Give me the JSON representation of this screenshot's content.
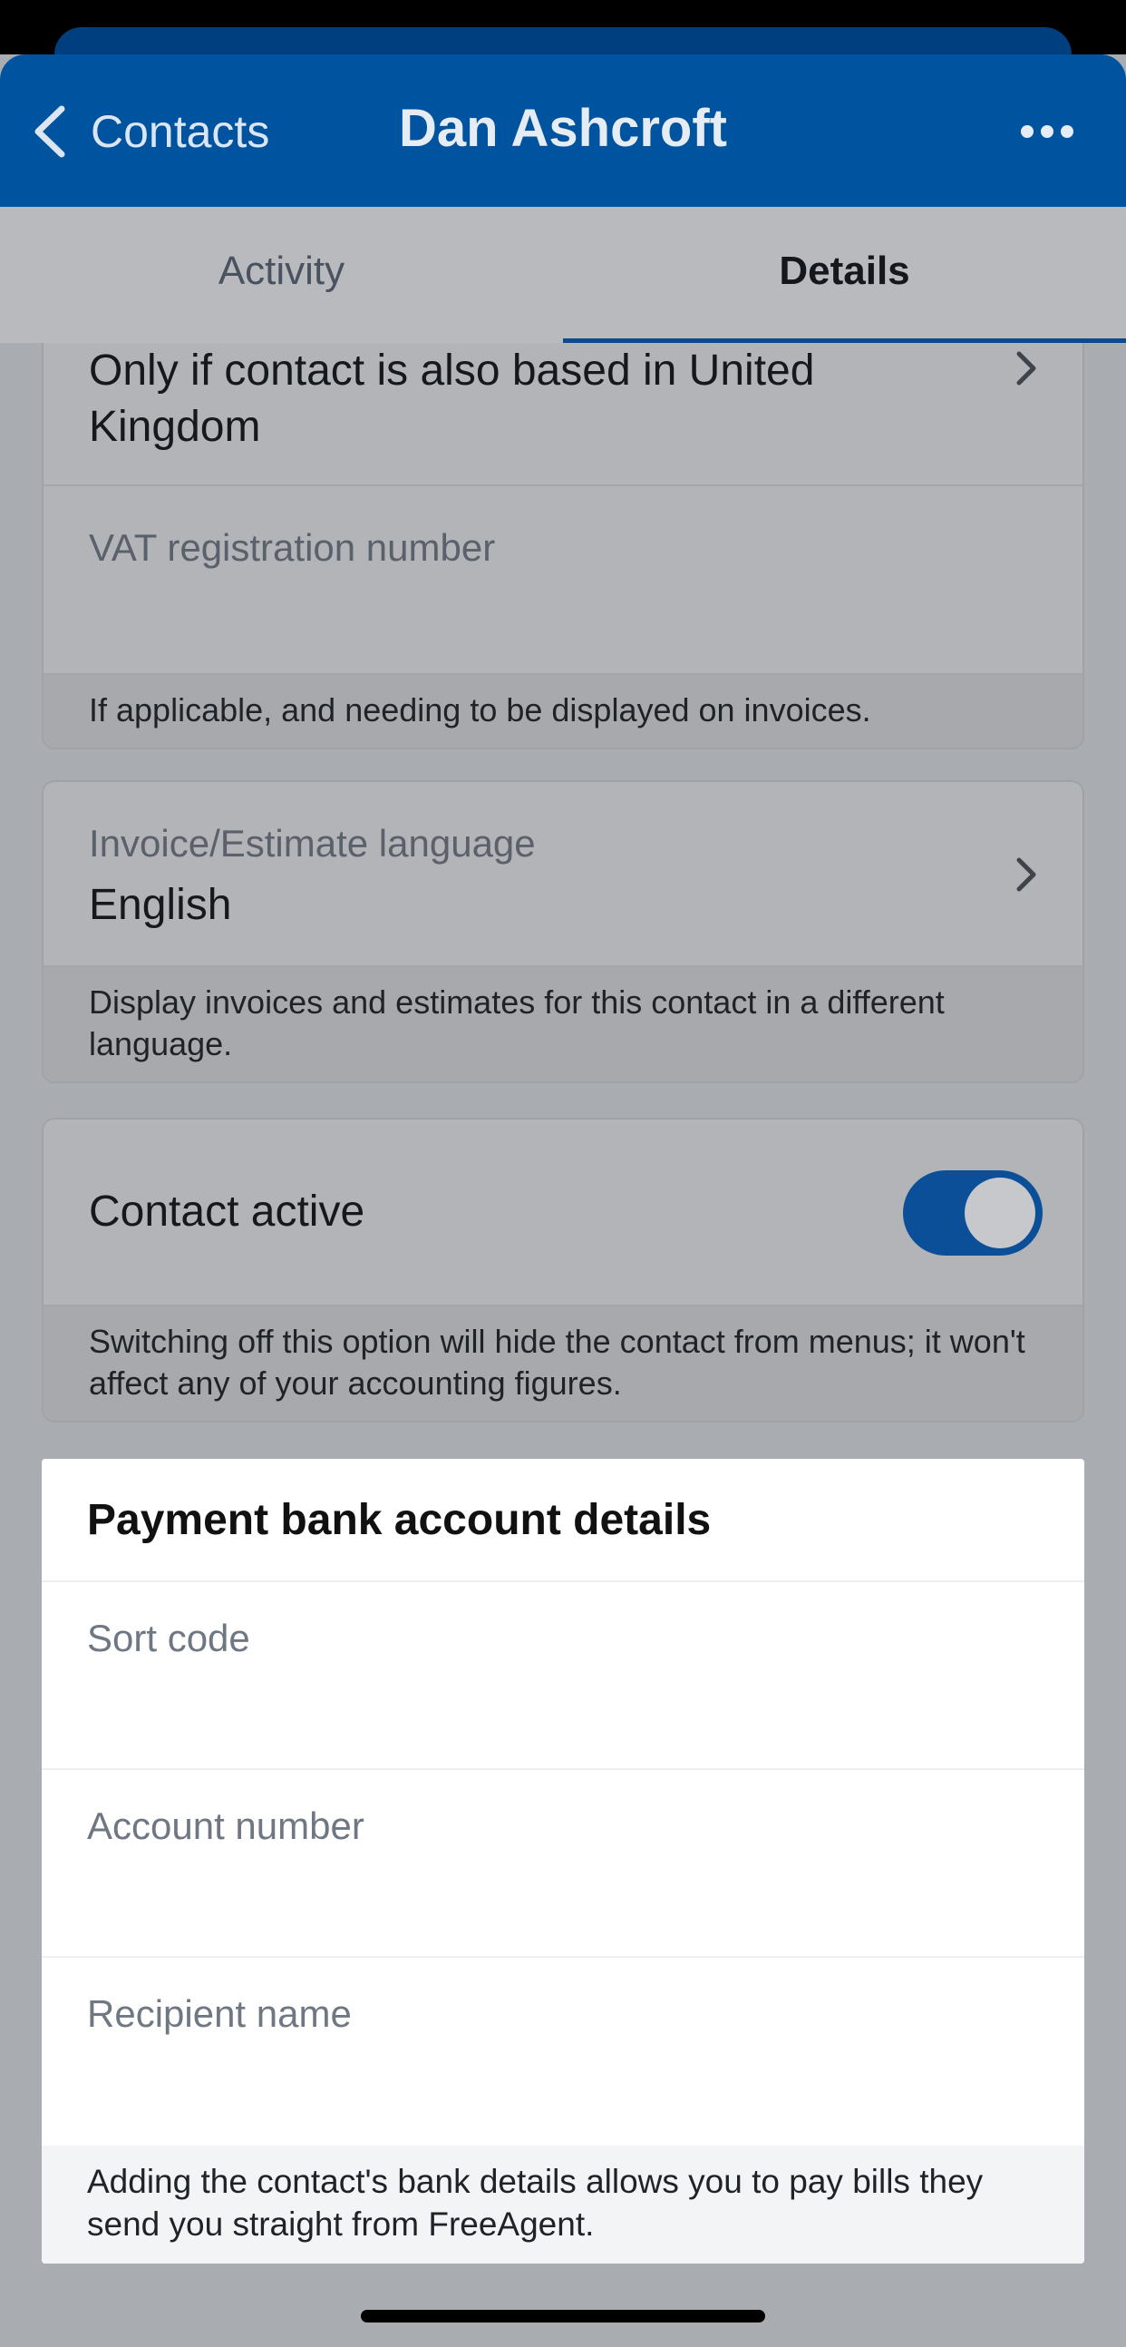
{
  "nav": {
    "back_label": "Contacts",
    "title": "Dan Ashcroft"
  },
  "tabs": [
    {
      "label": "Activity",
      "active": false
    },
    {
      "label": "Details",
      "active": true
    }
  ],
  "tax_card": {
    "value": "Only if contact is also based in United Kingdom",
    "vat_label": "VAT registration number",
    "hint": "If applicable, and needing to be displayed on invoices."
  },
  "language_card": {
    "label": "Invoice/Estimate language",
    "value": "English",
    "hint": "Display invoices and estimates for this contact in a different language."
  },
  "active_card": {
    "label": "Contact active",
    "toggle_on": true,
    "hint": "Switching off this option will hide the contact from menus; it won't affect any of your accounting figures."
  },
  "bank_card": {
    "title": "Payment bank account details",
    "sort_code_placeholder": "Sort code",
    "account_number_placeholder": "Account number",
    "recipient_name_placeholder": "Recipient name",
    "hint": "Adding the contact's bank details allows you to pay bills they send you straight from FreeAgent."
  },
  "colors": {
    "primary": "#00549f",
    "toggle_on": "#0a4f97"
  }
}
